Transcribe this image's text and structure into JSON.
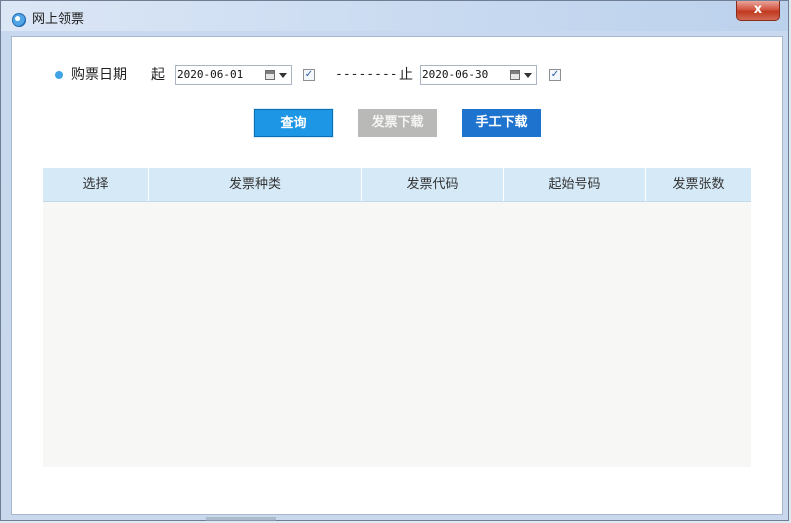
{
  "window": {
    "title": "网上领票",
    "close_label": "x"
  },
  "filter": {
    "label": "购票日期",
    "start_label": "起",
    "start_date": "2020-06-01",
    "start_checked": true,
    "separator": "--------",
    "end_label": "止",
    "end_date": "2020-06-30",
    "end_checked": true
  },
  "actions": {
    "query": "查询",
    "invoice_download": "发票下载",
    "manual_download": "手工下载"
  },
  "table": {
    "columns": [
      "选择",
      "发票种类",
      "发票代码",
      "起始号码",
      "发票张数"
    ],
    "rows": []
  },
  "colors": {
    "accent": "#1e96e6",
    "primary_button": "#1e73cf",
    "disabled_button": "#b9bab7",
    "table_header": "#d5e9f7"
  }
}
